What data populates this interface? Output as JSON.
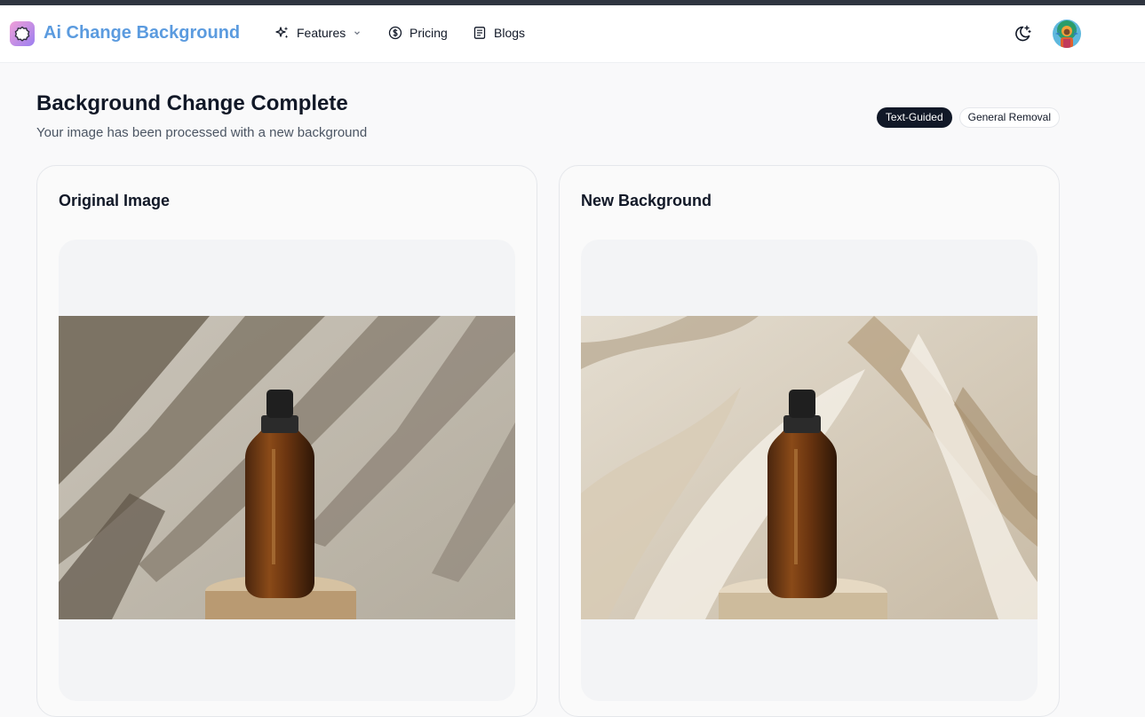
{
  "nav": {
    "brand": "Ai Change Background",
    "items": [
      {
        "label": "Features",
        "icon": "sparkles-icon",
        "has_dropdown": true
      },
      {
        "label": "Pricing",
        "icon": "dollar-circle-icon"
      },
      {
        "label": "Blogs",
        "icon": "document-list-icon"
      }
    ],
    "theme_icon": "moon-stars-icon"
  },
  "header": {
    "title": "Background Change Complete",
    "subtitle": "Your image has been processed with a new background",
    "modes": [
      {
        "label": "Text-Guided",
        "active": true
      },
      {
        "label": "General Removal",
        "active": false
      }
    ]
  },
  "cards": [
    {
      "title": "Original Image"
    },
    {
      "title": "New Background"
    }
  ],
  "colors": {
    "brand": "#5b9bdf",
    "active_tag": "#111827"
  }
}
